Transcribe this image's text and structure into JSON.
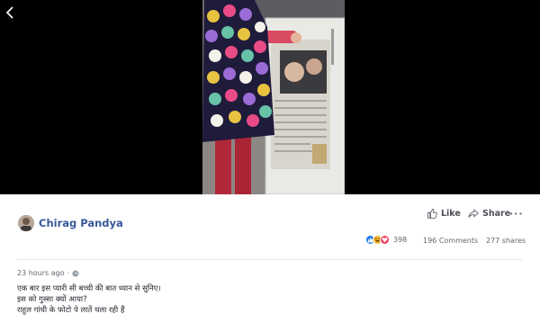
{
  "post": {
    "author": "Chirag Pandya",
    "timestamp": "23 hours ago",
    "separator": "·",
    "caption_lines": [
      "एक बार इस प्यारी सी बच्ची की बात ध्यान से सुनिए।",
      "इस को गुस्सा क्यों आया?",
      "राहुल गांधी के फोटो पे लातें चला रही हैं"
    ]
  },
  "actions": {
    "like_label": "Like",
    "share_label": "Share",
    "more_label": "···"
  },
  "stats": {
    "reactions_count": "398",
    "comments": "196 Comments",
    "shares": "277 shares"
  },
  "icons": {
    "back": "chevron-left-icon",
    "like": "thumbs-up-icon",
    "share": "share-arrow-icon",
    "privacy": "globe-icon",
    "reactions": [
      "like-reaction-icon",
      "haha-reaction-icon",
      "love-reaction-icon"
    ]
  },
  "colors": {
    "author_link": "#365899",
    "like_reaction": "#1877f2",
    "haha_reaction": "#f7b125",
    "love_reaction": "#f33e58",
    "video_bg": "#000000"
  }
}
